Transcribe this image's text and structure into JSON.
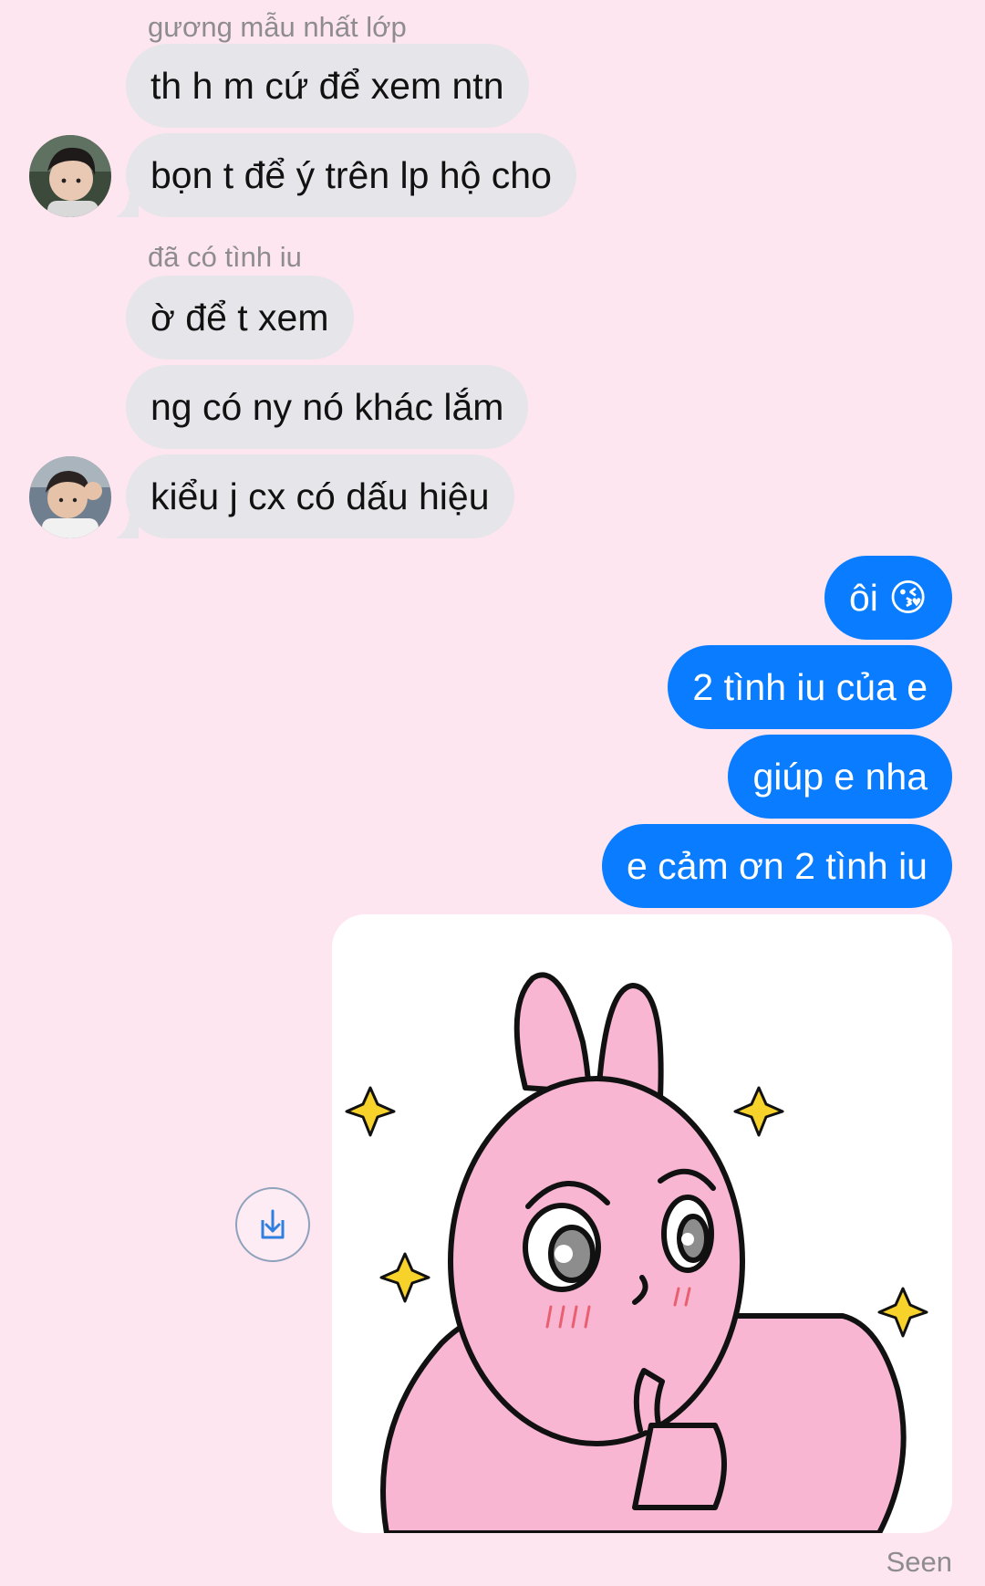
{
  "messages": {
    "group1_sender": "gương mẫu nhất lớp",
    "group1": [
      "th h m cứ để xem ntn",
      "bọn t để ý trên lp hộ cho"
    ],
    "group2_sender": "đã có tình iu",
    "group2": [
      "ờ để t xem",
      "ng có ny nó khác lắm",
      "kiểu j cx có dấu hiệu"
    ],
    "outgoing": [
      "ôi 😘",
      "2 tình iu của e",
      "giúp e nha",
      "e cảm ơn 2 tình iu"
    ]
  },
  "status": {
    "seen": "Seen"
  },
  "icons": {
    "save": "download-icon",
    "sticker": "pink-rabbit-sticker"
  },
  "colors": {
    "background": "#fde6ef",
    "incoming_bubble": "#e6e5ea",
    "outgoing_bubble": "#0a7cff",
    "meta_text": "#8e8c91"
  }
}
